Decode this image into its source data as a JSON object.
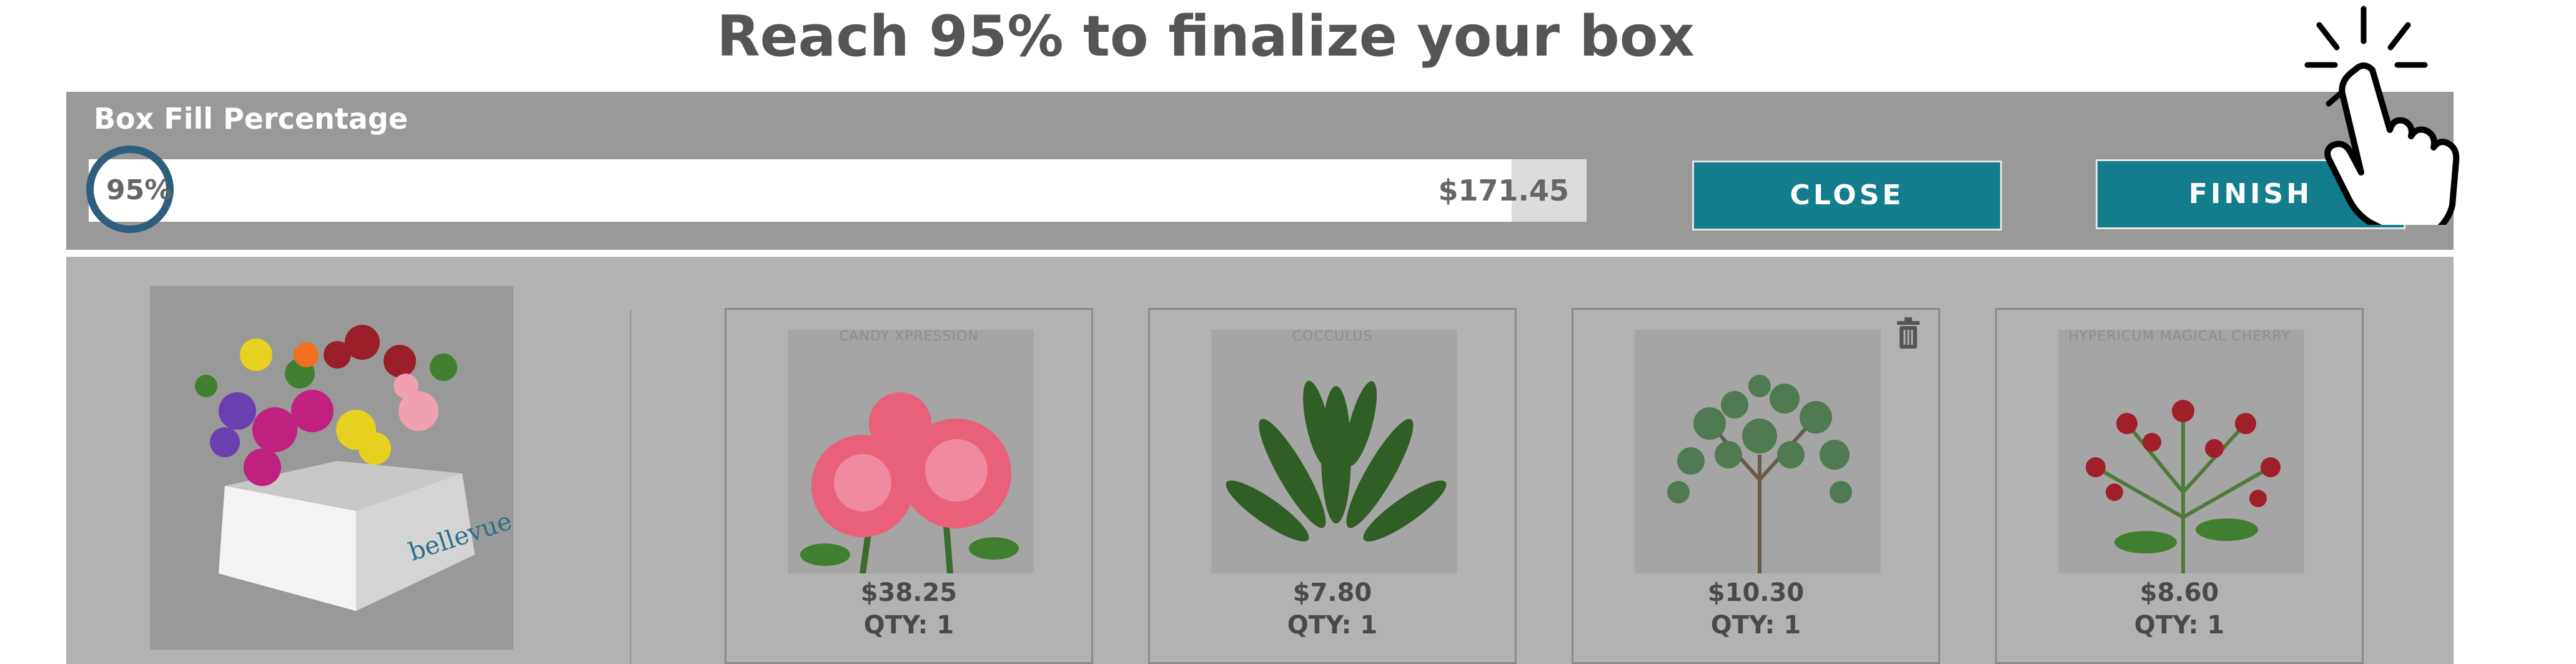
{
  "headline": "Reach 95% to finalize your box",
  "fill": {
    "label": "Box Fill Percentage",
    "percent_text": "95%",
    "percent_value": 95,
    "price": "$171.45"
  },
  "buttons": {
    "close": "CLOSE",
    "finish": "FINISH"
  },
  "icons": {
    "cursor": "click-hand-icon",
    "trash": "trash-icon"
  },
  "colors": {
    "button": "#137d8d",
    "highlight_ring": "#2d5f7d",
    "headline": "#555555"
  },
  "products": [
    {
      "name": "CANDY XPRESSION",
      "price": "$38.25",
      "qty": "QTY: 1"
    },
    {
      "name": "COCCULUS",
      "price": "$7.80",
      "qty": "QTY: 1"
    },
    {
      "name": "",
      "price": "$10.30",
      "qty": "QTY: 1"
    },
    {
      "name": "HYPERICUM MAGICAL CHERRY",
      "price": "$8.60",
      "qty": "QTY: 1"
    }
  ]
}
